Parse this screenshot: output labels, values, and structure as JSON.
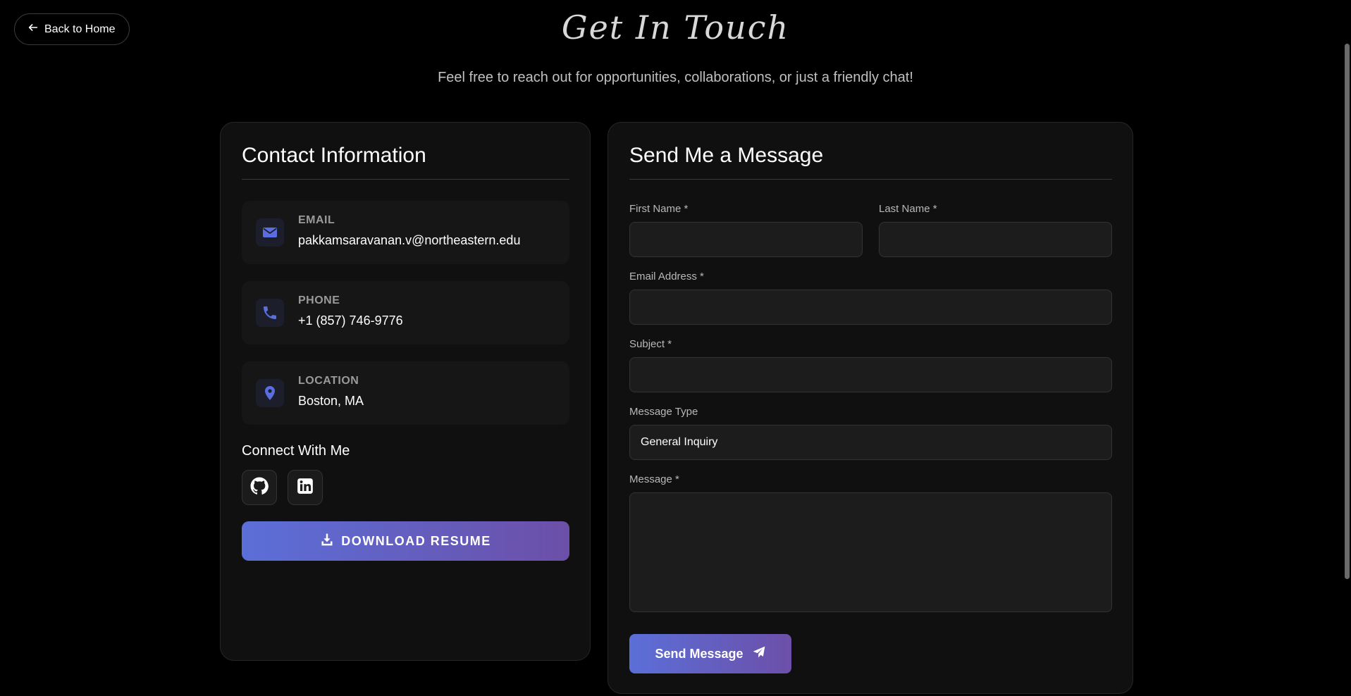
{
  "nav": {
    "back_label": "Back to Home"
  },
  "header": {
    "title": "Get In Touch",
    "subtitle": "Feel free to reach out for opportunities, collaborations, or just a friendly chat!"
  },
  "contact_info": {
    "title": "Contact Information",
    "items": [
      {
        "label": "EMAIL",
        "value": "pakkamsaravanan.v@northeastern.edu",
        "icon": "envelope-icon"
      },
      {
        "label": "PHONE",
        "value": "+1 (857) 746-9776",
        "icon": "phone-icon"
      },
      {
        "label": "LOCATION",
        "value": "Boston, MA",
        "icon": "map-pin-icon"
      }
    ],
    "connect_title": "Connect With Me",
    "social": [
      {
        "name": "GitHub",
        "icon": "github-icon"
      },
      {
        "name": "LinkedIn",
        "icon": "linkedin-icon"
      }
    ],
    "download_label": "DOWNLOAD RESUME"
  },
  "form": {
    "title": "Send Me a Message",
    "first_name": {
      "label": "First Name *",
      "value": ""
    },
    "last_name": {
      "label": "Last Name *",
      "value": ""
    },
    "email": {
      "label": "Email Address *",
      "value": ""
    },
    "subject": {
      "label": "Subject *",
      "value": ""
    },
    "message_type": {
      "label": "Message Type",
      "value": "General Inquiry"
    },
    "message": {
      "label": "Message *",
      "value": ""
    },
    "submit_label": "Send Message"
  },
  "colors": {
    "background": "#000000",
    "card": "#101010",
    "accent_start": "#5b6fd8",
    "accent_end": "#6c4fa8",
    "icon_accent": "#5b6ee0"
  }
}
